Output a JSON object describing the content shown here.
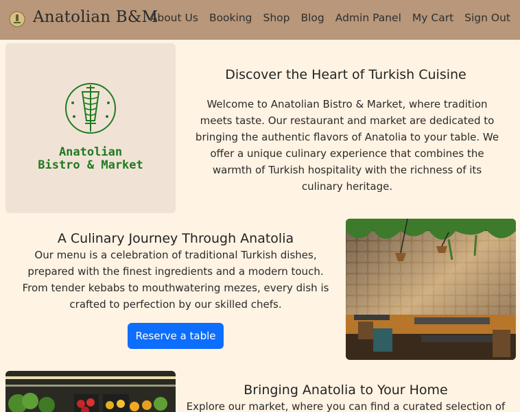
{
  "navbar": {
    "brand": "Anatolian B&M",
    "links": [
      {
        "label": "About Us"
      },
      {
        "label": "Booking"
      },
      {
        "label": "Shop"
      },
      {
        "label": "Blog"
      },
      {
        "label": "Admin Panel"
      },
      {
        "label": "My Cart"
      },
      {
        "label": "Sign Out"
      }
    ]
  },
  "logo_card": {
    "line1": "Anatolian",
    "line2": "Bistro & Market",
    "icon": "doner-kebab-icon",
    "color": "#1f7a1f"
  },
  "sections": {
    "discover": {
      "title": "Discover the Heart of Turkish Cuisine",
      "body": "Welcome to Anatolian Bistro & Market, where tradition meets taste. Our restaurant and market are dedicated to bringing the authentic flavors of Anatolia to your table. We offer a unique culinary experience that combines the warmth of Turkish hospitality with the richness of its culinary heritage."
    },
    "journey": {
      "title": "A Culinary Journey Through Anatolia",
      "body": "Our menu is a celebration of traditional Turkish dishes, prepared with the finest ingredients and a modern touch. From tender kebabs to mouthwatering mezes, every dish is crafted to perfection by our skilled chefs.",
      "button": "Reserve a table"
    },
    "home": {
      "title": "Bringing Anatolia to Your Home",
      "body": "Explore our market, where you can find a curated selection of"
    }
  },
  "colors": {
    "page_bg": "#fff3e3",
    "navbar_bg": "#b8977a",
    "button_bg": "#0d6efd"
  }
}
